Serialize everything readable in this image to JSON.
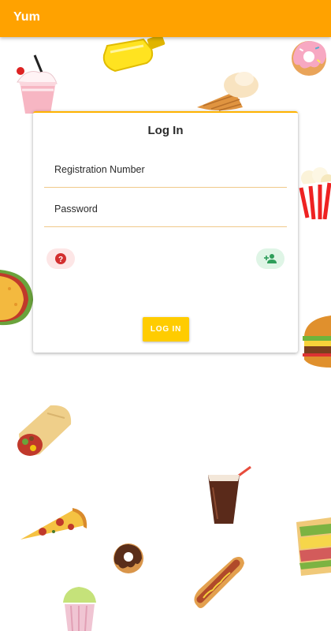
{
  "app_bar": {
    "title": "Yum",
    "color": "#ffa200"
  },
  "login_card": {
    "title": "Log In",
    "fields": [
      {
        "label": "Registration Number",
        "value": ""
      },
      {
        "label": "Password",
        "value": ""
      }
    ],
    "help_icon": "question-circle-icon",
    "add_user_icon": "person-add-icon",
    "login_button_label": "LOG IN",
    "accent": "#ffcc00"
  },
  "background_icons": [
    "milkshake-icon",
    "mustard-bottle-icon",
    "ice-cream-cone-icon",
    "donut-icon",
    "popcorn-icon",
    "taco-icon",
    "burger-icon",
    "burrito-icon",
    "cola-icon",
    "pizza-slice-icon",
    "chocolate-donut-icon",
    "sandwich-icon",
    "hotdog-icon",
    "cupcake-icon"
  ]
}
